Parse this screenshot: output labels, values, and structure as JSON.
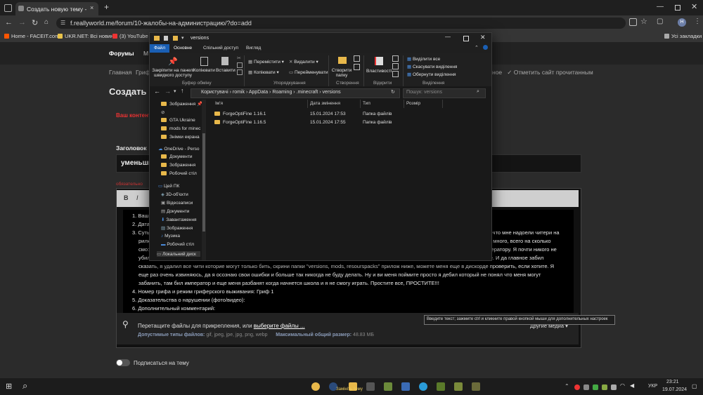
{
  "browser": {
    "tab_title": "Создать новую тему - ReallyW",
    "url": "f.reallyworld.me/forum/10-жалобы-на-администрацию/?do=add",
    "bookmarks": [
      "Home - FACEIT.com",
      "UKR.NET: Всі новин...",
      "(3) YouTube"
    ],
    "all_bookmarks": "Усі закладки",
    "profile_initial": "Н"
  },
  "site": {
    "nav_forums": "Форумы",
    "nav_more": "М",
    "breadcrumb_home": "Главная",
    "breadcrumb_gr": "Гриф",
    "page_title": "Создать н",
    "notice": "Ваш контент",
    "mark_read": "Отметить сайт прочитанным",
    "title_label": "Заголовок",
    "title_value": "уменьши",
    "required": "обязательно",
    "list": {
      "item1": "Ваш",
      "item2": "Дата",
      "item3": "Суть",
      "item3_rest1": "ому-что мне надоели читери на",
      "line_l2": "рилк",
      "line_r2": "у не много, всего на сколько",
      "line_l3": "смо:",
      "line_r3": "модератору. Я почти никого не",
      "line_l4": "убил",
      "line_r4": "ойте. И да главное забил",
      "line5": "сказать, я удалил все чити которие могут только бить, скрини папки \"versions, mods, resourspacks\" прилож ниже, можете меня еще в дискорде проверить, если хотите. Я",
      "line6": "еще раз очень извиняюсь, да я осознаю свои ошибки и больше так никогда не буду делать. Ну и ви меня поймите просто я дебил который не понял что меня могут",
      "line7": "забанить, там бил император и еще меня разбанят когда начнется школа и я не смогу играть. Простите все, ПРОСТИТЕ!!!",
      "item4": "Номер грифа и режим гриферского выживания: Гриф 1",
      "item5": "Доказательства о нарушении (фото/видео):",
      "item6": "Дополнительный комментарий:"
    },
    "attach_text": "Перетащите файлы для прикрепления, или ",
    "attach_link": "выберите файлы ...",
    "other_media": "Другие медиа ▾",
    "allowed_label": "Допустимые типы файлов:",
    "allowed_types": "gif, jpeg, jpe, jpg, png, webp",
    "max_label": "Максимальный общий размер:",
    "max_size": "48.83 МБ",
    "subscribe": "Подписаться на тему",
    "tooltip": "Введите текст; зажмите ctrl и кликните правой кнопкой мыши для дополнительных настроек",
    "bold": "B",
    "italic": "I"
  },
  "explorer": {
    "title": "versions",
    "tabs": [
      "Файл",
      "Основне",
      "Спільний доступ",
      "Вигляд"
    ],
    "ribbon": {
      "pin": "Закріпити на панелі швидкого доступу",
      "copy": "Копіювати",
      "paste": "Вставити",
      "clipboard_group": "Буфер обміну",
      "move": "Перемістити",
      "copyto": "Копіювати",
      "delete": "Видалити",
      "rename": "Перейменувати",
      "organize_group": "Упорядкування",
      "newfolder": "Створити папку",
      "create_group": "Створення",
      "properties": "Властивості",
      "open_group": "Відкрити",
      "select_all": "Виділити все",
      "select_none": "Скасувати виділення",
      "invert": "Обернути виділення",
      "select_group": "Виділення"
    },
    "path": [
      "Користувачі",
      "romik",
      "AppData",
      "Roaming",
      ".minecraft",
      "versions"
    ],
    "search_placeholder": "Пошук: versions",
    "nav_items": [
      "Зображення",
      "",
      "GTA Ukraine",
      "mods for minec",
      "Знімки екрана",
      "OneDrive - Perso",
      "Документи",
      "Зображення",
      "Робочий стіл",
      "Цей ПК",
      "3D-об'єкти",
      "Відеозаписи",
      "Документи",
      "Завантаження",
      "Зображення",
      "Музика",
      "Робочий стіл",
      "Локальний диск"
    ],
    "columns": [
      "Ім'я",
      "Дата змінення",
      "Тип",
      "Розмір"
    ],
    "rows": [
      {
        "name": "ForgeOptiFine 1.16.1",
        "date": "15.01.2024 17:53",
        "type": "Папка файлів"
      },
      {
        "name": "ForgeOptiFine 1.16.5",
        "date": "15.01.2024 17:55",
        "type": "Папка файлів"
      }
    ]
  },
  "taskbar": {
    "time": "23:21",
    "date": "19.07.2024",
    "lang": "УКР",
    "overlay": "Замініть тему"
  }
}
